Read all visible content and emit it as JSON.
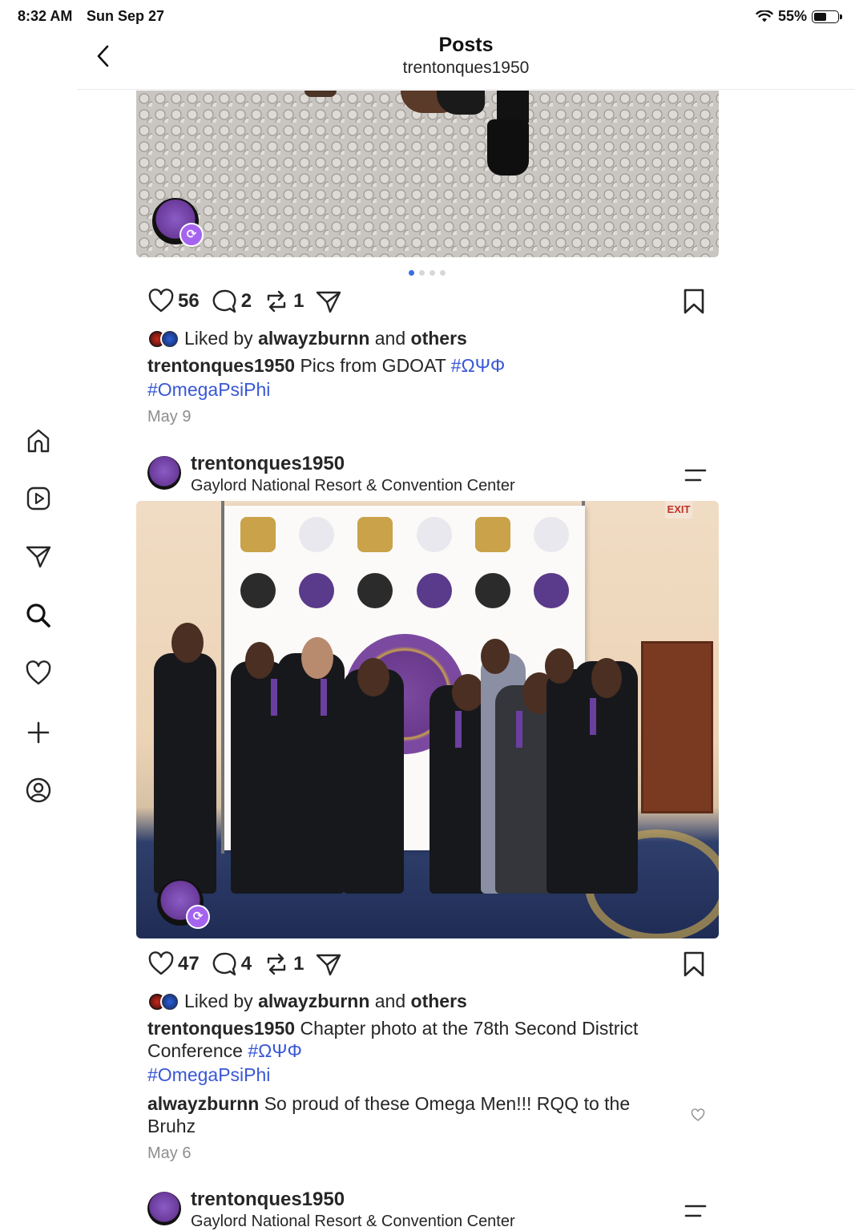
{
  "status_bar": {
    "time": "8:32 AM",
    "date": "Sun Sep 27",
    "battery": "55%",
    "battery_level": 0.55
  },
  "header": {
    "title": "Posts",
    "username": "trentonques1950"
  },
  "sidebar": {
    "items": [
      "home-icon",
      "reels-icon",
      "send-icon",
      "search-icon",
      "heart-icon",
      "create-icon",
      "profile-icon"
    ]
  },
  "post1": {
    "likes_count": "56",
    "comments_count": "2",
    "reposts_count": "1",
    "liked_by_prefix": "Liked by",
    "liked_by_user": "alwayzburnn",
    "liked_by_and": "and",
    "liked_by_others": "others",
    "caption_user": "trentonques1950",
    "caption_text": "Pics from GDOAT",
    "tag1": "#ΩΨΦ",
    "tag2": "#OmegaPsiPhi",
    "date": "May 9",
    "carousel_index": 1,
    "carousel_total": 4
  },
  "post2": {
    "username": "trentonques1950",
    "location": "Gaylord National Resort & Convention Center",
    "likes_count": "47",
    "comments_count": "4",
    "reposts_count": "1",
    "liked_by_prefix": "Liked by",
    "liked_by_user": "alwayzburnn",
    "liked_by_and": "and",
    "liked_by_others": "others",
    "caption_user": "trentonques1950",
    "caption_text": "Chapter photo at the 78th Second District Conference",
    "tag1": "#ΩΨΦ",
    "tag2": "#OmegaPsiPhi",
    "comment_user": "alwayzburnn",
    "comment_text": "So proud of these Omega Men!!! RQQ to the Bruhz",
    "date": "May 6",
    "photo_text": {
      "exit_sign": "EXIT"
    }
  },
  "post3": {
    "username": "trentonques1950",
    "location": "Gaylord National Resort & Convention Center"
  },
  "colors": {
    "accent": "#3857d6",
    "repost_badge": "#a564f0",
    "muted": "#8e8e8e"
  }
}
